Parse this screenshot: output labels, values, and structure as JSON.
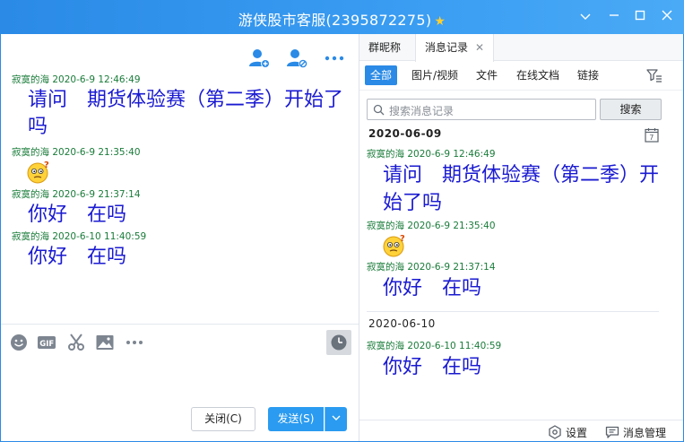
{
  "window": {
    "title": "游侠股市客服(2395872275)",
    "star": "★"
  },
  "left": {
    "messages": [
      {
        "sender": "寂寞的海",
        "time": "2020-6-9 12:46:49",
        "text": "请问　期货体验赛（第二季）开始了吗"
      },
      {
        "sender": "寂寞的海",
        "time": "2020-6-9 21:35:40",
        "emoji": "confused-face"
      },
      {
        "sender": "寂寞的海",
        "time": "2020-6-9 21:37:14",
        "text": "你好　在吗"
      },
      {
        "sender": "寂寞的海",
        "time": "2020-6-10 11:40:59",
        "text": "你好　在吗"
      }
    ],
    "close_label": "关闭(C)",
    "send_label": "发送(S)"
  },
  "right": {
    "tabs": [
      "群昵称",
      "消息记录"
    ],
    "filters": [
      "全部",
      "图片/视频",
      "文件",
      "在线文档",
      "链接"
    ],
    "search_placeholder": "搜索消息记录",
    "search_button": "搜索",
    "groups": [
      {
        "date": "2020-06-09",
        "messages": [
          {
            "sender": "寂寞的海",
            "time": "2020-6-9 12:46:49",
            "text": "请问　期货体验赛（第二季）开始了吗"
          },
          {
            "sender": "寂寞的海",
            "time": "2020-6-9 21:35:40",
            "emoji": "confused-face"
          },
          {
            "sender": "寂寞的海",
            "time": "2020-6-9 21:37:14",
            "text": "你好　在吗"
          }
        ]
      },
      {
        "date": "2020-06-10",
        "messages": [
          {
            "sender": "寂寞的海",
            "time": "2020-6-10 11:40:59",
            "text": "你好　在吗"
          }
        ]
      }
    ],
    "bottom": {
      "settings": "设置",
      "manage": "消息管理"
    }
  },
  "colors": {
    "title_bar": "#2a8ae6",
    "accent": "#2a9bf0",
    "sender_green": "#1a7c3a",
    "message_blue": "#1a1ad1"
  }
}
